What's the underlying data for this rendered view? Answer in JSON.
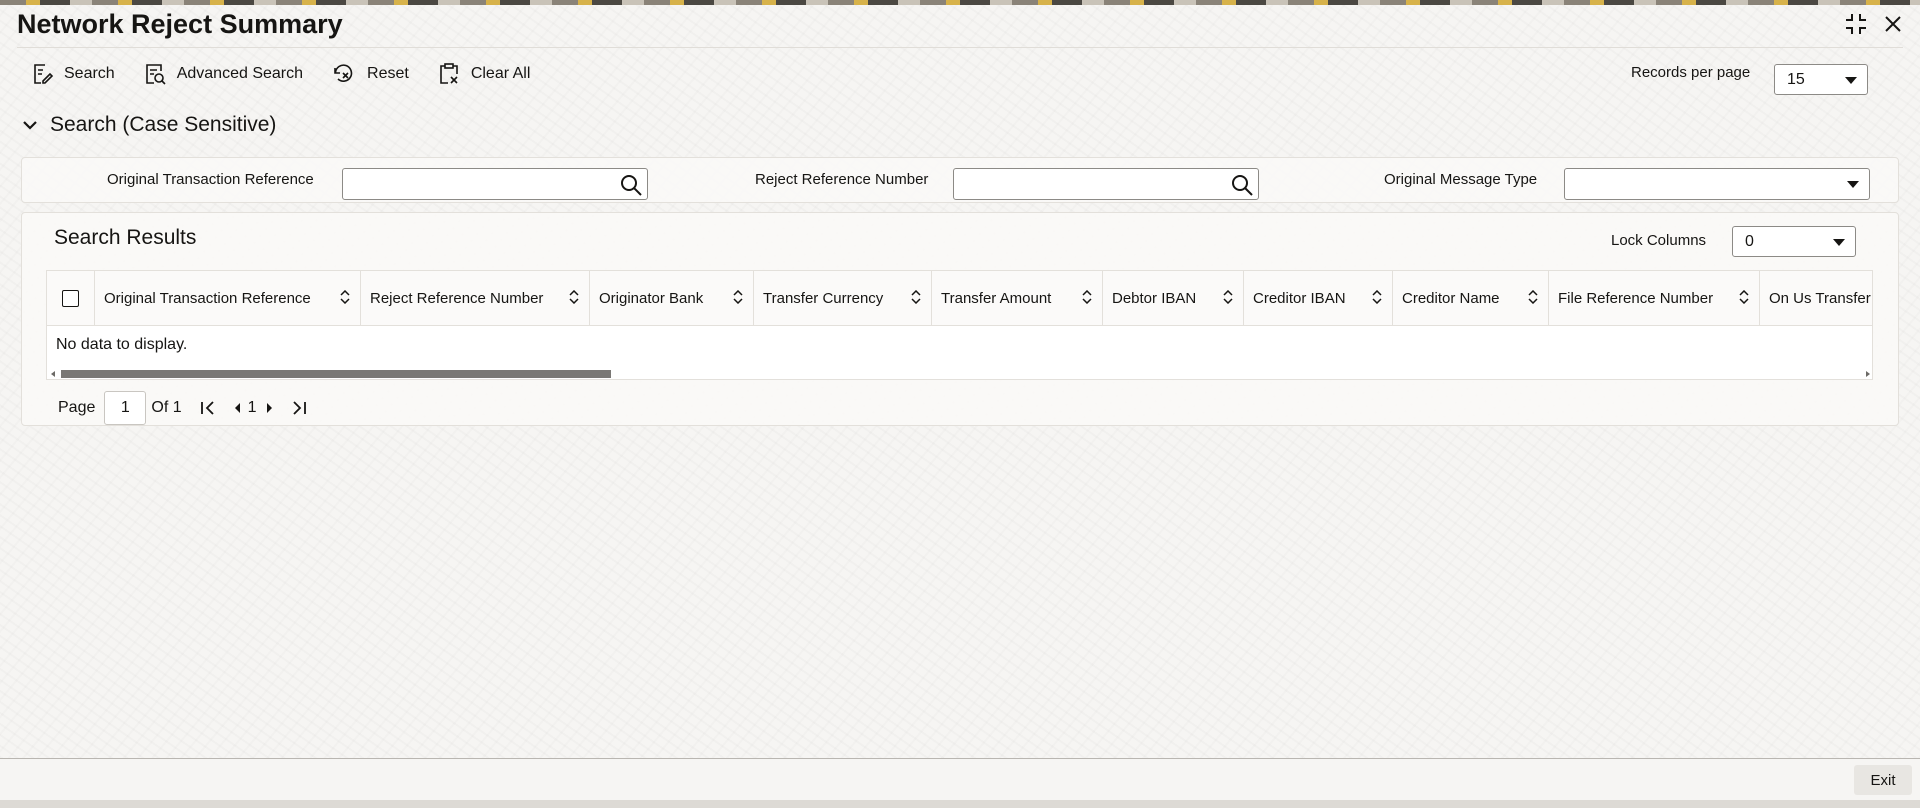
{
  "window": {
    "title": "Network Reject Summary"
  },
  "toolbar": {
    "search_label": "Search",
    "advanced_search_label": "Advanced Search",
    "reset_label": "Reset",
    "clear_all_label": "Clear All"
  },
  "records_per_page": {
    "label": "Records per page",
    "value": "15"
  },
  "search_section": {
    "title": "Search (Case Sensitive)",
    "fields": [
      {
        "label": "Original Transaction Reference",
        "value": ""
      },
      {
        "label": "Reject Reference Number",
        "value": ""
      },
      {
        "label": "Original Message Type",
        "value": ""
      }
    ]
  },
  "results": {
    "title": "Search Results",
    "lock_columns_label": "Lock Columns",
    "lock_columns_value": "0",
    "columns": [
      "Original Transaction Reference",
      "Reject Reference Number",
      "Originator Bank",
      "Transfer Currency",
      "Transfer Amount",
      "Debtor IBAN",
      "Creditor IBAN",
      "Creditor Name",
      "File Reference Number",
      "On Us Transfer"
    ],
    "empty_message": "No data to display."
  },
  "pagination": {
    "page_label": "Page",
    "current_page": "1",
    "of_label": "Of 1",
    "page_link": "1"
  },
  "footer": {
    "exit_label": "Exit"
  }
}
